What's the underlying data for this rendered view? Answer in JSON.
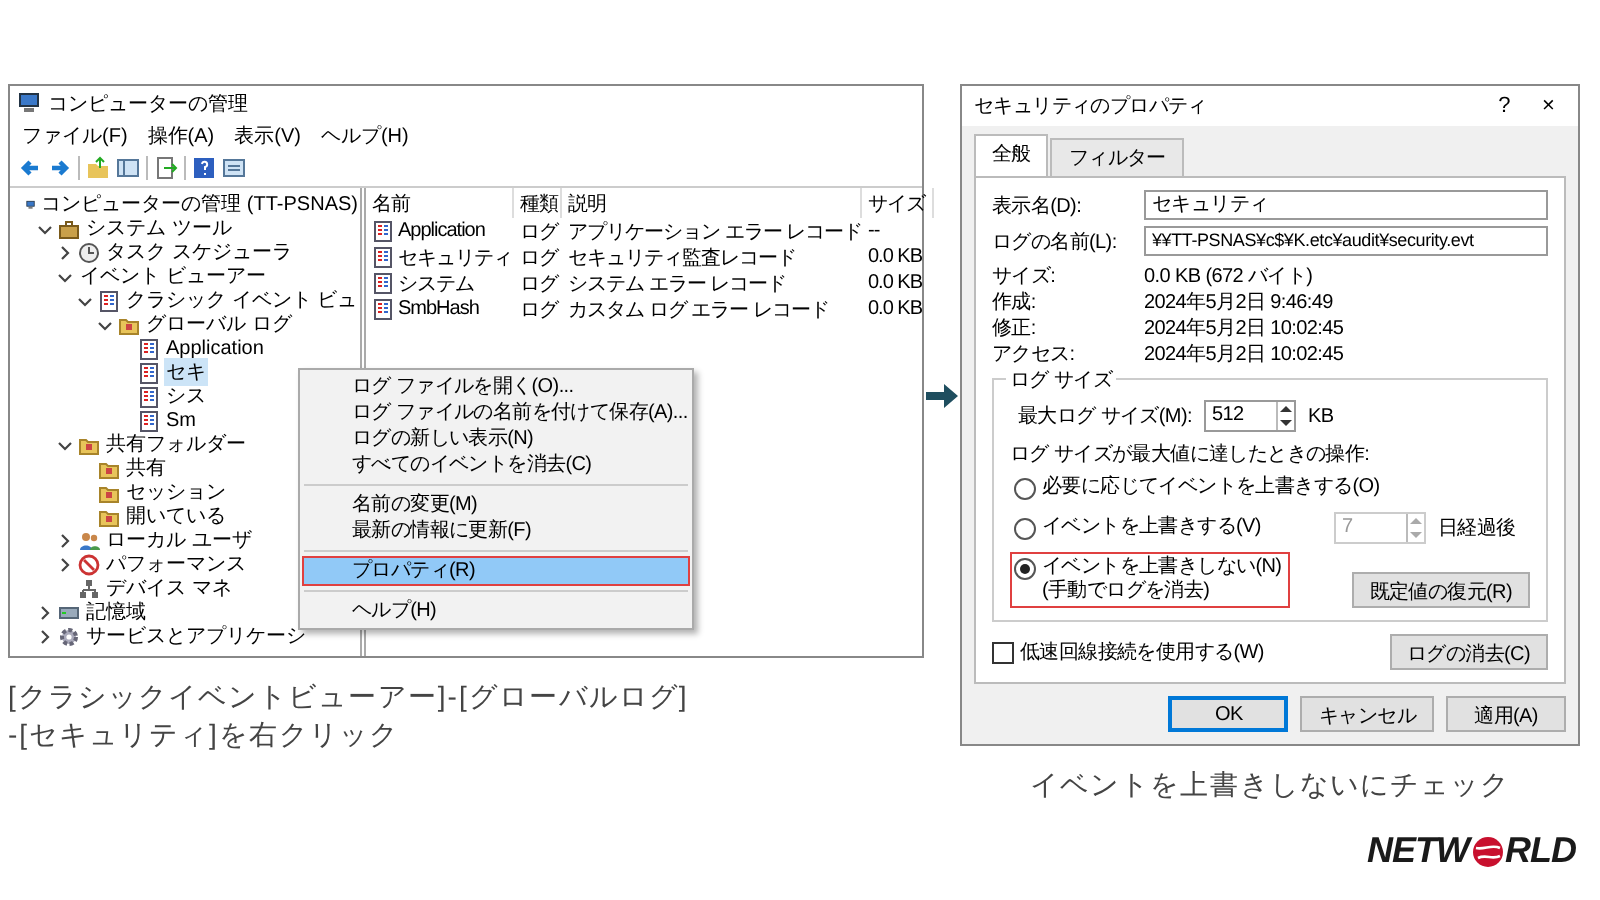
{
  "left_window": {
    "title": "コンピューターの管理",
    "menu": [
      "ファイル(F)",
      "操作(A)",
      "表示(V)",
      "ヘルプ(H)"
    ],
    "tree": [
      {
        "label": "コンピューターの管理 (TT-PSNAS)",
        "kind": "computer",
        "selected": false,
        "children": [
          {
            "label": "システム ツール",
            "kind": "toolbox",
            "expanded": true,
            "selected": false,
            "children": [
              {
                "label": "タスク スケジューラ",
                "kind": "clock",
                "expanded": false,
                "selected": false
              },
              {
                "label": "イベント ビューアー",
                "kind": "plain",
                "expanded": true,
                "selected": false,
                "children": [
                  {
                    "label": "クラシック イベント ビュ",
                    "kind": "log",
                    "expanded": true,
                    "selected": false,
                    "children": [
                      {
                        "label": "グローバル ログ",
                        "kind": "folder",
                        "expanded": true,
                        "selected": false,
                        "children": [
                          {
                            "label": "Application",
                            "kind": "log",
                            "selected": false
                          },
                          {
                            "label": "セキ",
                            "kind": "log",
                            "selected": true
                          },
                          {
                            "label": "シス",
                            "kind": "log",
                            "selected": false
                          },
                          {
                            "label": "Sm",
                            "kind": "log",
                            "selected": false
                          }
                        ]
                      }
                    ]
                  }
                ]
              },
              {
                "label": "共有フォルダー",
                "kind": "folder",
                "expanded": true,
                "selected": false,
                "children": [
                  {
                    "label": "共有",
                    "kind": "folder",
                    "selected": false
                  },
                  {
                    "label": "セッション",
                    "kind": "folder",
                    "selected": false
                  },
                  {
                    "label": "開いている",
                    "kind": "folder",
                    "selected": false
                  }
                ]
              },
              {
                "label": "ローカル ユーザ",
                "kind": "users",
                "expanded": false,
                "selected": false
              },
              {
                "label": "パフォーマンス",
                "kind": "gauge",
                "expanded": false,
                "selected": false
              },
              {
                "label": "デバイス マネ",
                "kind": "device",
                "selected": false
              }
            ]
          },
          {
            "label": "記憶域",
            "kind": "disk",
            "expanded": false,
            "selected": false
          },
          {
            "label": "サービスとアプリケーシ",
            "kind": "gear",
            "expanded": false,
            "selected": false
          }
        ]
      }
    ],
    "list": {
      "columns": [
        "名前",
        "種類",
        "説明",
        "サイズ"
      ],
      "rows": [
        {
          "name": "Application",
          "type": "ログ",
          "description": "アプリケーション エラー レコード",
          "size": "--"
        },
        {
          "name": "セキュリティ",
          "type": "ログ",
          "description": "セキュリティ監査レコード",
          "size": "0.0 KB"
        },
        {
          "name": "システム",
          "type": "ログ",
          "description": "システム エラー レコード",
          "size": "0.0 KB"
        },
        {
          "name": "SmbHash",
          "type": "ログ",
          "description": "カスタム ログ エラー レコード",
          "size": "0.0 KB"
        }
      ]
    },
    "context_menu": {
      "groups": [
        [
          {
            "label": "ログ ファイルを開く(O)...",
            "selected": false,
            "highlighted": false
          },
          {
            "label": "ログ ファイルの名前を付けて保存(A)...",
            "selected": false,
            "highlighted": false
          },
          {
            "label": "ログの新しい表示(N)",
            "selected": false,
            "highlighted": false
          },
          {
            "label": "すべてのイベントを消去(C)",
            "selected": false,
            "highlighted": false
          }
        ],
        [
          {
            "label": "名前の変更(M)",
            "selected": false,
            "highlighted": false
          },
          {
            "label": "最新の情報に更新(F)",
            "selected": false,
            "highlighted": false
          }
        ],
        [
          {
            "label": "プロパティ(R)",
            "selected": true,
            "highlighted": true
          }
        ],
        [
          {
            "label": "ヘルプ(H)",
            "selected": false,
            "highlighted": false
          }
        ]
      ]
    }
  },
  "left_caption": "[クラシックイベントビューアー]-[グローバルログ]\n-[セキュリティ]を右クリック",
  "right_dialog": {
    "title": "セキュリティのプロパティ",
    "title_buttons": [
      "?",
      "×"
    ],
    "tabs": [
      {
        "label": "全般",
        "selected": true
      },
      {
        "label": "フィルター",
        "selected": false
      }
    ],
    "fields": [
      {
        "label": "表示名(D):",
        "value": "セキュリティ"
      },
      {
        "label": "ログの名前(L):",
        "value": "¥¥TT-PSNAS¥c$¥K.etc¥audit¥security.evt"
      }
    ],
    "info": [
      {
        "label": "サイズ:",
        "value": "0.0 KB (672 バイト)"
      },
      {
        "label": "作成:",
        "value": "2024年5月2日 9:46:49"
      },
      {
        "label": "修正:",
        "value": "2024年5月2日 10:02:45"
      },
      {
        "label": "アクセス:",
        "value": "2024年5月2日 10:02:45"
      }
    ],
    "log_size": {
      "title": "ログ サイズ",
      "max_label": "最大ログ サイズ(M):",
      "max_value": "512",
      "max_unit": "KB",
      "action_label": "ログ サイズが最大値に達したときの操作:",
      "options": [
        {
          "label": "必要に応じてイベントを上書きする(O)",
          "selected": false,
          "highlighted": false
        },
        {
          "label": "イベントを上書きする(V)",
          "selected": false,
          "highlighted": false,
          "days": {
            "value": "7",
            "disabled": true,
            "unit": "日経過後"
          }
        },
        {
          "label": "イベントを上書きしない(N)\n(手動でログを消去)",
          "selected": true,
          "highlighted": true
        }
      ],
      "restore_button": "既定値の復元(R)"
    },
    "low_speed": {
      "label": "低速回線接続を使用する(W)",
      "checked": false
    },
    "clear_button": "ログの消去(C)",
    "buttons": [
      {
        "label": "OK",
        "default": true
      },
      {
        "label": "キャンセル",
        "default": false
      },
      {
        "label": "適用(A)",
        "default": false
      }
    ]
  },
  "right_caption": "イベントを上書きしないにチェック",
  "logo": {
    "before": "NETW",
    "after": "RLD"
  }
}
